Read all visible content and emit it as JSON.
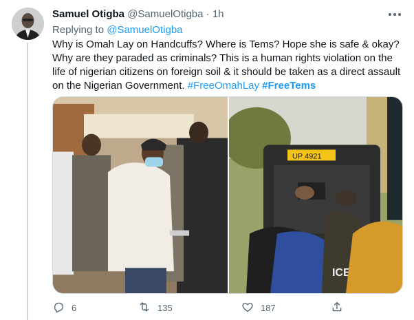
{
  "tweet": {
    "author_name": "Samuel Otigba",
    "author_handle": "@SamuelOtigba",
    "separator": "·",
    "time": "1h",
    "more_icon": "more-horizontal-icon",
    "replying_label": "Replying to",
    "replying_mention": "@SamuelOtigba",
    "text_body": "Why is Omah Lay on Handcuffs? Where is Tems? Hope she is safe & okay? Why are they paraded as criminals? This is a human rights violation on the life of nigerian citizens on foreign soil & it should be taken as a direct assault on the Nigerian Government.",
    "hashtag_1": "#FreeOmahLay",
    "hashtag_2": "#FreeTems",
    "photo_right_plate": "UP 4921",
    "photo_right_police": "ICE"
  },
  "actions": {
    "reply": {
      "icon": "reply-icon",
      "count": "6"
    },
    "retweet": {
      "icon": "retweet-icon",
      "count": "135"
    },
    "like": {
      "icon": "heart-icon",
      "count": "187"
    },
    "share": {
      "icon": "share-icon"
    }
  },
  "colors": {
    "link": "#1d9bf0",
    "secondary_text": "#536471",
    "border": "#cfd9de"
  }
}
